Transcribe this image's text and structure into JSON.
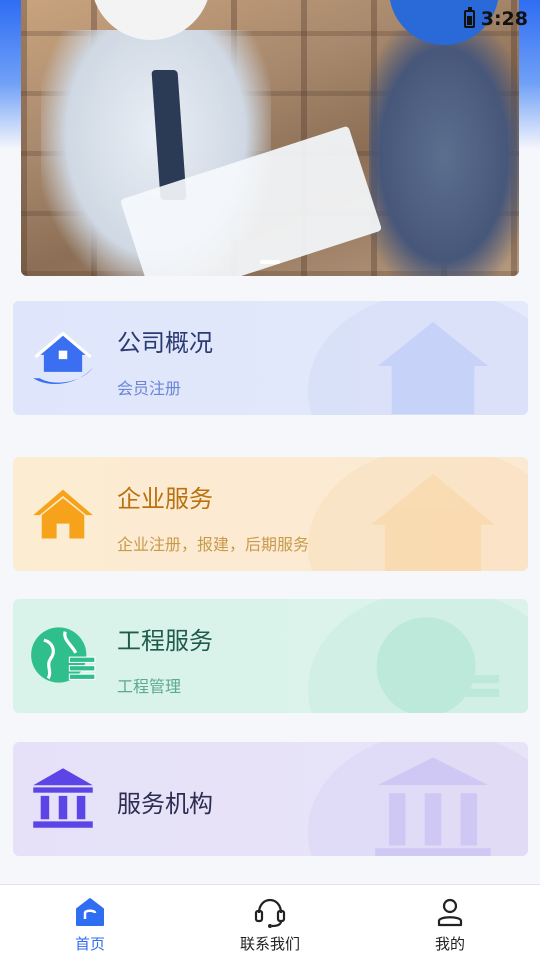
{
  "status_bar": {
    "time": "3:28"
  },
  "banner": {
    "dots": 1
  },
  "cards": [
    {
      "title": "公司概况",
      "subtitle": "会员注册",
      "icon": "house-icon",
      "accent": "#3a6ff2"
    },
    {
      "title": "企业服务",
      "subtitle": "企业注册，报建，后期服务",
      "icon": "home-icon",
      "accent": "#f7a21b"
    },
    {
      "title": "工程服务",
      "subtitle": "工程管理",
      "icon": "globe-icon",
      "accent": "#2fbf8d"
    },
    {
      "title": "服务机构",
      "subtitle": "",
      "icon": "institution-icon",
      "accent": "#5b45e6"
    }
  ],
  "tabbar": {
    "items": [
      {
        "label": "首页",
        "icon": "home-tab-icon",
        "active": true
      },
      {
        "label": "联系我们",
        "icon": "headset-icon",
        "active": false
      },
      {
        "label": "我的",
        "icon": "user-icon",
        "active": false
      }
    ],
    "active_color": "#2f6df3"
  }
}
